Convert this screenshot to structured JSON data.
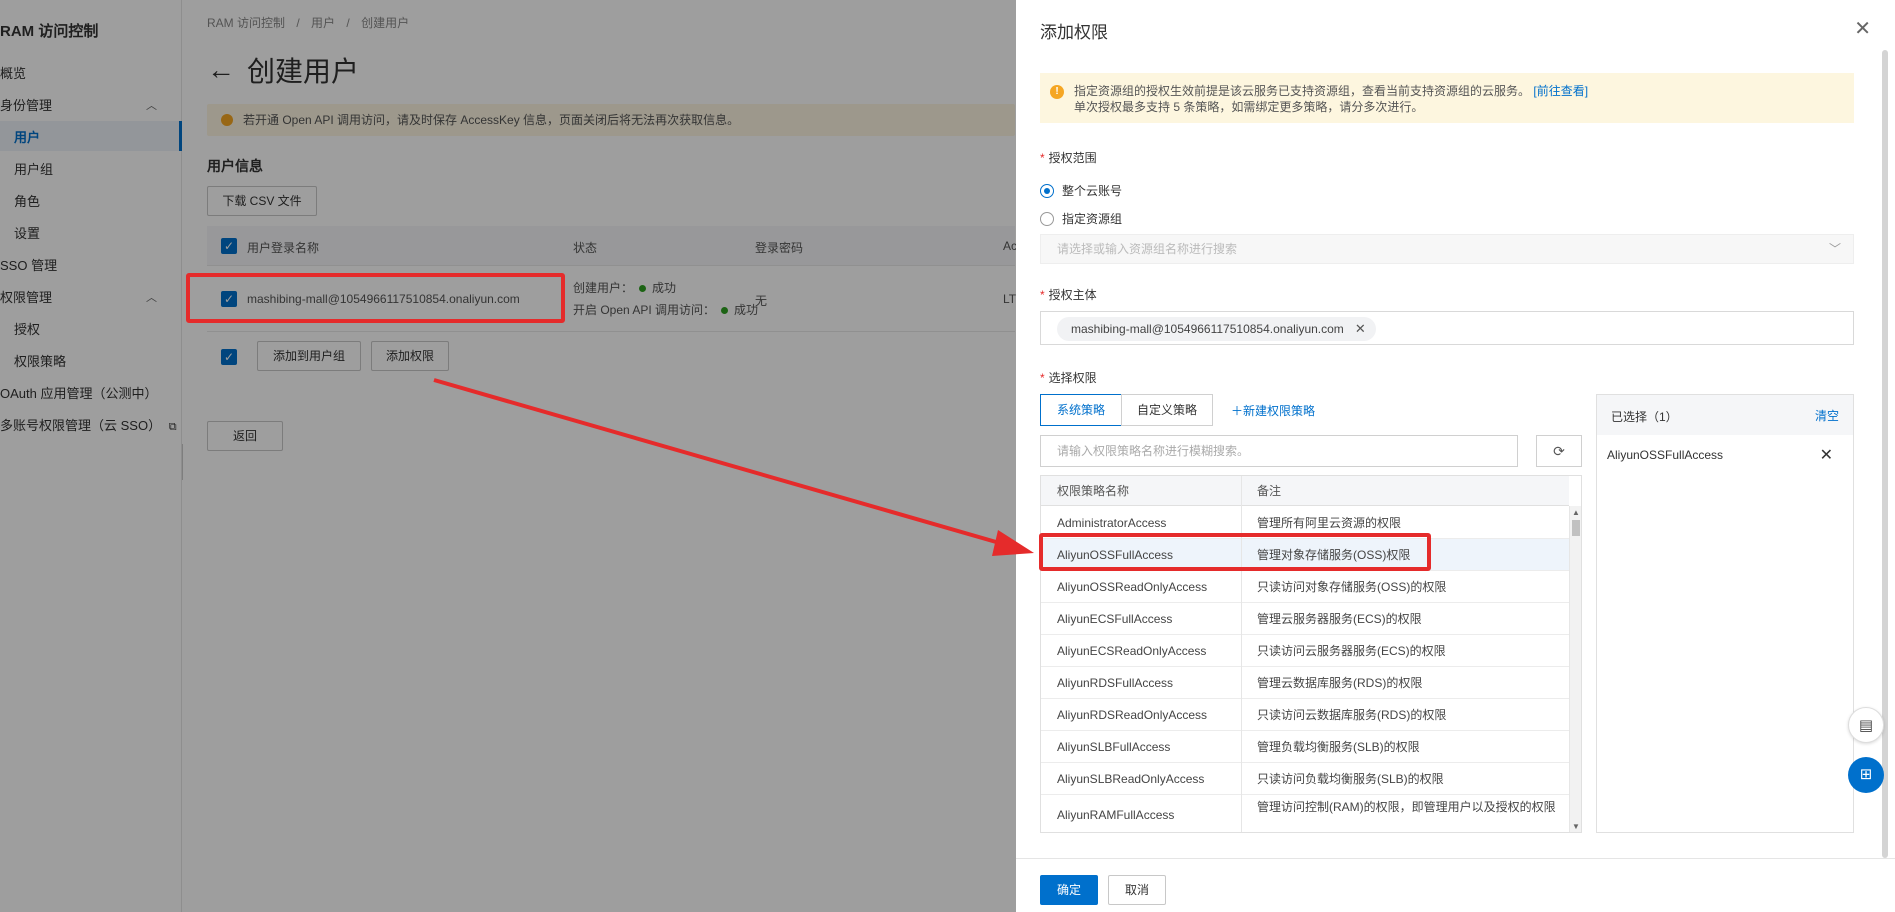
{
  "sidebar": {
    "title": "RAM 访问控制",
    "items": [
      {
        "label": "概览"
      },
      {
        "label": "身份管理"
      },
      {
        "label": "用户"
      },
      {
        "label": "用户组"
      },
      {
        "label": "角色"
      },
      {
        "label": "设置"
      },
      {
        "label": "SSO 管理"
      },
      {
        "label": "权限管理"
      },
      {
        "label": "授权"
      },
      {
        "label": "权限策略"
      },
      {
        "label": "OAuth 应用管理（公测中）"
      },
      {
        "label": "多账号权限管理（云 SSO）"
      }
    ]
  },
  "main": {
    "breadcrumb": [
      "RAM 访问控制",
      "/",
      "用户",
      "/",
      "创建用户"
    ],
    "title": "创建用户",
    "notice": "若开通 Open API 调用访问，请及时保存 AccessKey 信息，页面关闭后将无法再次获取信息。",
    "section_title": "用户信息",
    "csv_button": "下载 CSV 文件",
    "table": {
      "headers": [
        "用户登录名称",
        "状态",
        "登录密码",
        "Ac"
      ],
      "row": {
        "login_name": "mashibing-mall@1054966117510854.onaliyun.com",
        "status_create_label": "创建用户：",
        "status_create_value": "成功",
        "status_api_label": "开启 Open API 调用访问：",
        "status_api_value": "成功",
        "password": "无",
        "ak": "LT"
      }
    },
    "add_group_button": "添加到用户组",
    "add_permission_button": "添加权限",
    "back_button": "返回"
  },
  "drawer": {
    "title": "添加权限",
    "warning_line1": "指定资源组的授权生效前提是该云服务已支持资源组，查看当前支持资源组的云服务。",
    "warning_link": "[前往查看]",
    "warning_line2": "单次授权最多支持 5 条策略，如需绑定更多策略，请分多次进行。",
    "scope_label": "授权范围",
    "scope_option_all": "整个云账号",
    "scope_option_group": "指定资源组",
    "group_select_placeholder": "请选择或输入资源组名称进行搜索",
    "principal_label": "授权主体",
    "principal_tag": "mashibing-mall@1054966117510854.onaliyun.com",
    "policy_label": "选择权限",
    "tab_system": "系统策略",
    "tab_custom": "自定义策略",
    "new_policy": "新建权限策略",
    "search_placeholder": "请输入权限策略名称进行模糊搜索。",
    "policy_headers": [
      "权限策略名称",
      "备注"
    ],
    "policies": [
      {
        "name": "AdministratorAccess",
        "note": "管理所有阿里云资源的权限"
      },
      {
        "name": "AliyunOSSFullAccess",
        "note": "管理对象存储服务(OSS)权限"
      },
      {
        "name": "AliyunOSSReadOnlyAccess",
        "note": "只读访问对象存储服务(OSS)的权限"
      },
      {
        "name": "AliyunECSFullAccess",
        "note": "管理云服务器服务(ECS)的权限"
      },
      {
        "name": "AliyunECSReadOnlyAccess",
        "note": "只读访问云服务器服务(ECS)的权限"
      },
      {
        "name": "AliyunRDSFullAccess",
        "note": "管理云数据库服务(RDS)的权限"
      },
      {
        "name": "AliyunRDSReadOnlyAccess",
        "note": "只读访问云数据库服务(RDS)的权限"
      },
      {
        "name": "AliyunSLBFullAccess",
        "note": "管理负载均衡服务(SLB)的权限"
      },
      {
        "name": "AliyunSLBReadOnlyAccess",
        "note": "只读访问负载均衡服务(SLB)的权限"
      },
      {
        "name": "AliyunRAMFullAccess",
        "note": "管理访问控制(RAM)的权限，即管理用户以及授权的权限"
      }
    ],
    "selected_title": "已选择（1）",
    "clear": "清空",
    "selected_items": [
      "AliyunOSSFullAccess"
    ],
    "ok_button": "确定",
    "cancel_button": "取消"
  },
  "colors": {
    "accent": "#0070cc",
    "highlight_red": "#e52b2b",
    "warning_bg": "#fdf6df"
  }
}
